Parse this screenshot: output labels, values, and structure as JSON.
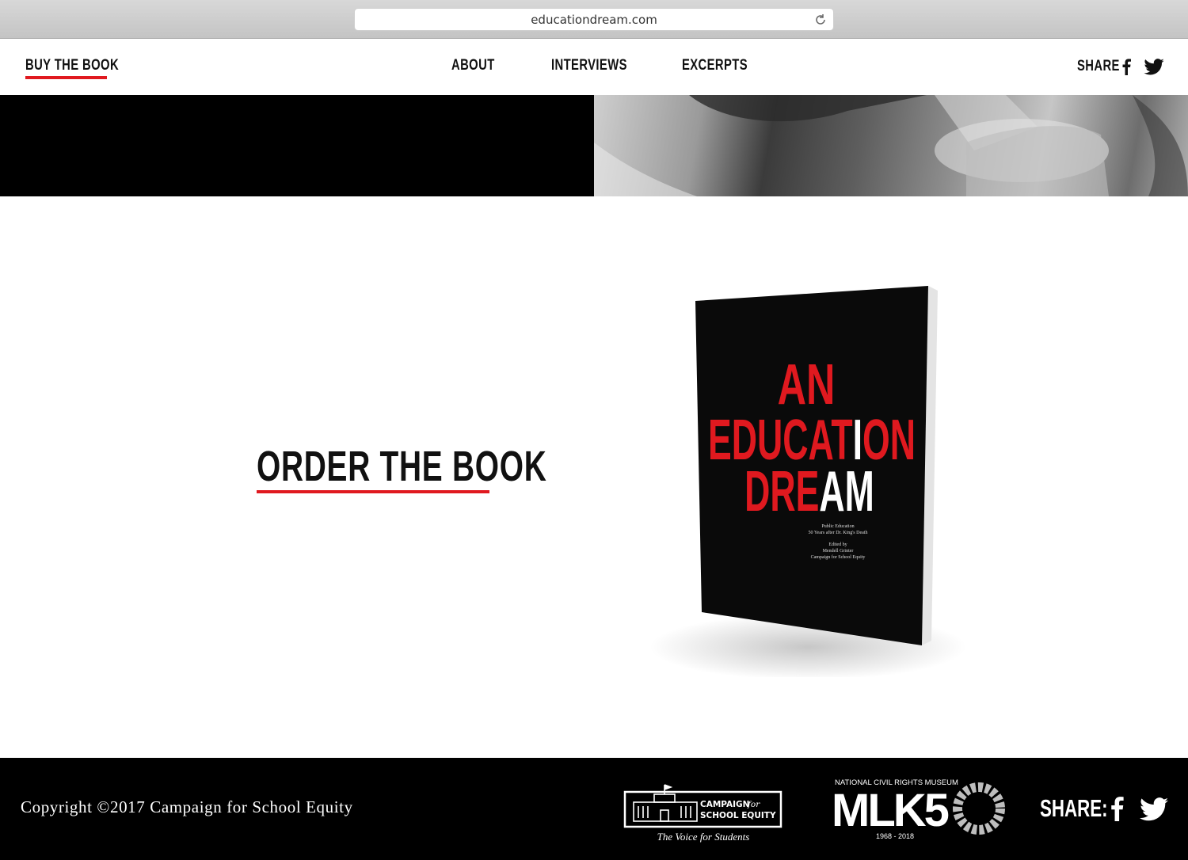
{
  "browser": {
    "url": "educationdream.com"
  },
  "nav": {
    "buy_label": "BUY THE BOOK",
    "about_label": "ABOUT",
    "interviews_label": "INTERVIEWS",
    "excerpts_label": "EXCERPTS",
    "share_label": "SHARE"
  },
  "main": {
    "order_label": "ORDER THE BOOK"
  },
  "book": {
    "title_line1": "AN",
    "title_line2_a": "EDUCAT",
    "title_line2_b": "I",
    "title_line2_c": "ON",
    "title_line3_a": "DRE",
    "title_line3_b": "AM",
    "subtitle_1": "Public Education",
    "subtitle_2": "50 Years after Dr. King's Death",
    "edited_1": "Edited by",
    "edited_2": "Mendell Grinter",
    "edited_3": "Campaign for School Equity"
  },
  "footer": {
    "copyright": "Copyright ©2017 Campaign for School Equity",
    "cse_line1_a": "CAMPAIGN",
    "cse_line1_b": "for",
    "cse_line2": "SCHOOL EQUITY",
    "cse_tagline": "The Voice for Students",
    "mlk_museum": "NATIONAL CIVIL RIGHTS MUSEUM",
    "mlk_big": "MLK5",
    "mlk_years": "1968 - 2018",
    "share_label": "SHARE:"
  },
  "colors": {
    "accent_red": "#e0191f",
    "black": "#000000",
    "white": "#ffffff"
  },
  "icons": [
    "reload-icon",
    "facebook-icon",
    "twitter-icon"
  ]
}
